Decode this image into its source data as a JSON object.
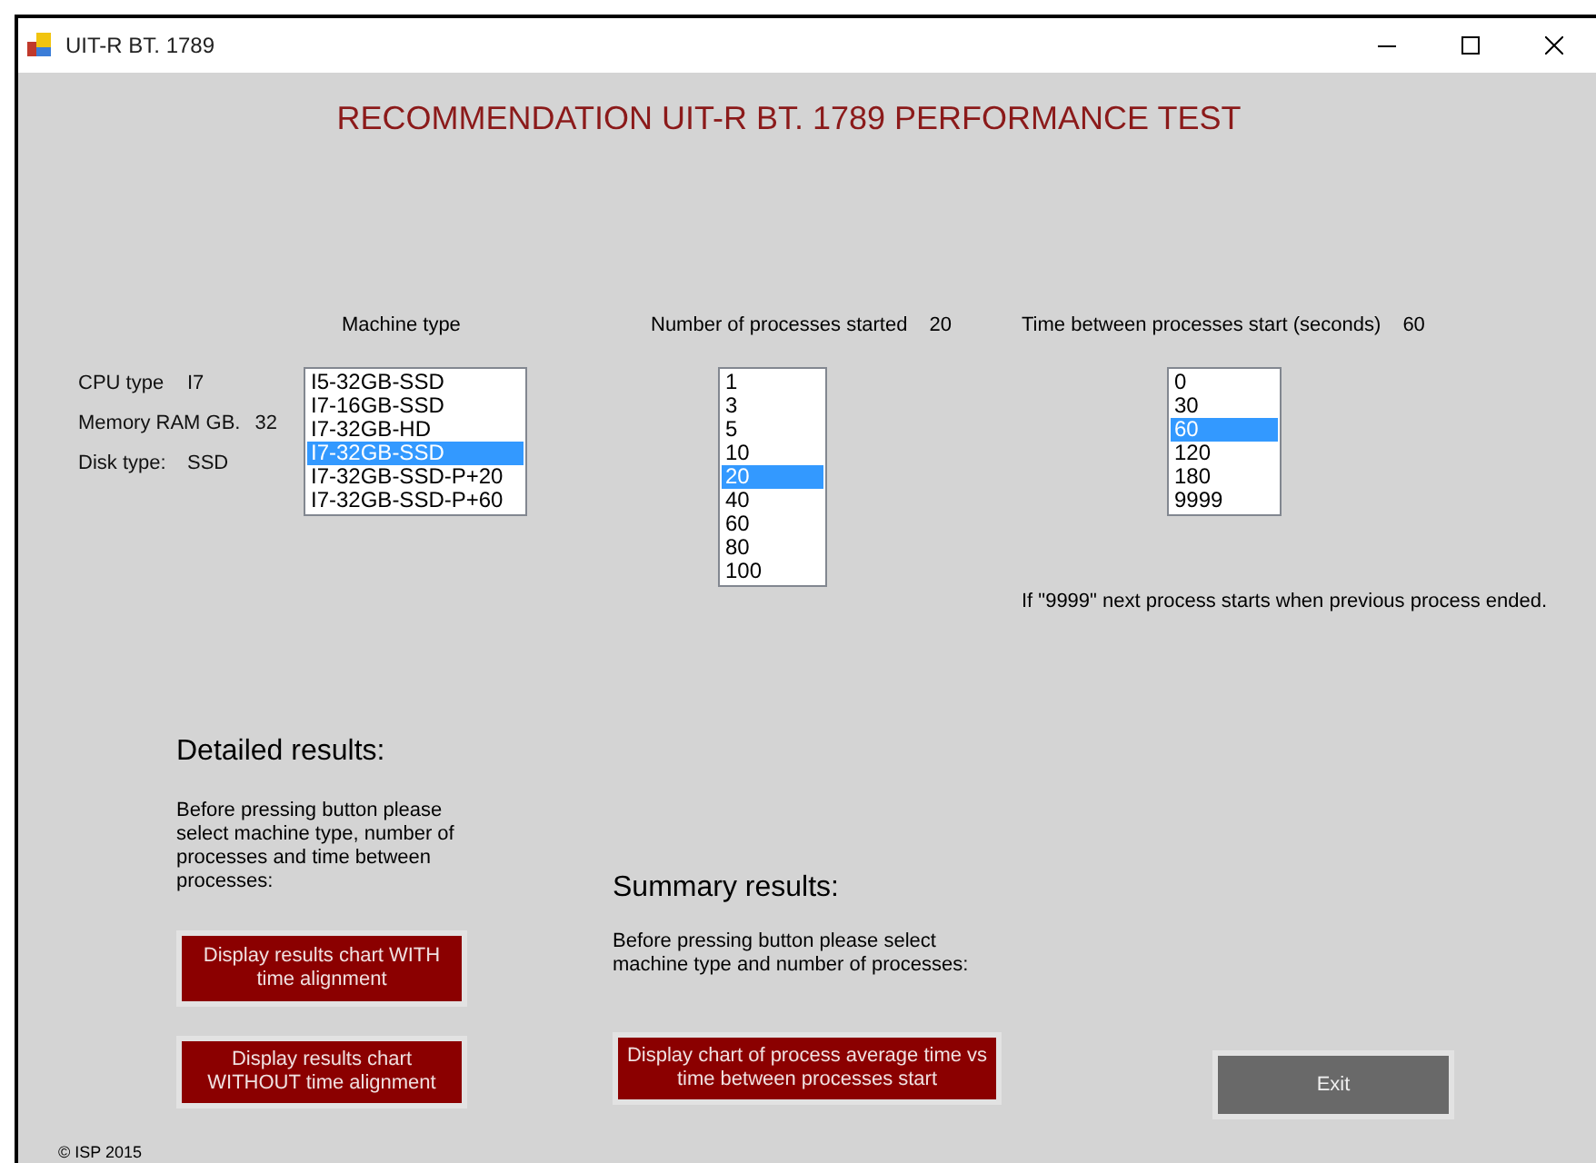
{
  "window": {
    "title": "UIT-R BT. 1789"
  },
  "heading": "RECOMMENDATION UIT-R BT. 1789 PERFORMANCE TEST",
  "machine_info": [
    {
      "label": "CPU type",
      "value": "I7"
    },
    {
      "label": "Memory RAM GB.",
      "value": "32"
    },
    {
      "label": "Disk type:",
      "value": "SSD"
    }
  ],
  "machine_type": {
    "label": "Machine type",
    "items": [
      {
        "label": "I5-32GB-SSD",
        "selected": false
      },
      {
        "label": "I7-16GB-SSD",
        "selected": false
      },
      {
        "label": "I7-32GB-HD",
        "selected": false
      },
      {
        "label": "I7-32GB-SSD",
        "selected": true
      },
      {
        "label": "I7-32GB-SSD-P+20",
        "selected": false
      },
      {
        "label": "I7-32GB-SSD-P+60",
        "selected": false
      }
    ]
  },
  "processes": {
    "label": "Number of processes started",
    "value": "20",
    "items": [
      {
        "label": "1",
        "selected": false
      },
      {
        "label": "3",
        "selected": false
      },
      {
        "label": "5",
        "selected": false
      },
      {
        "label": "10",
        "selected": false
      },
      {
        "label": "20",
        "selected": true
      },
      {
        "label": "40",
        "selected": false
      },
      {
        "label": "60",
        "selected": false
      },
      {
        "label": "80",
        "selected": false
      },
      {
        "label": "100",
        "selected": false
      }
    ]
  },
  "interval": {
    "label": "Time between processes start (seconds)",
    "value": "60",
    "items": [
      {
        "label": "0",
        "selected": false
      },
      {
        "label": "30",
        "selected": false
      },
      {
        "label": "60",
        "selected": true
      },
      {
        "label": "120",
        "selected": false
      },
      {
        "label": "180",
        "selected": false
      },
      {
        "label": "9999",
        "selected": false
      }
    ],
    "note": "If \"9999\" next process starts when previous process ended."
  },
  "detailed": {
    "title": "Detailed results:",
    "note": "Before pressing button please select machine type, number of processes and time between processes:",
    "buttons": [
      "Display results chart WITH time alignment",
      "Display results chart WITHOUT time alignment"
    ]
  },
  "summary": {
    "title": "Summary results:",
    "note": "Before pressing button please select machine type and number of processes:",
    "button": "Display chart of process average time vs time between processes start"
  },
  "exit_button": "Exit",
  "footer": "© ISP 2015"
}
